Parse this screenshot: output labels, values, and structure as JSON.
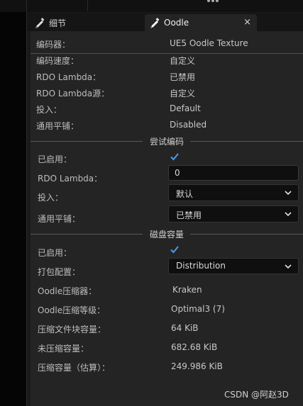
{
  "tabs": [
    {
      "label": "细节"
    },
    {
      "label": "Oodle",
      "close": "×"
    }
  ],
  "info": [
    {
      "label": "编码器：",
      "value": "UE5 Oodle Texture"
    },
    {
      "label": "编码速度：",
      "value": "自定义"
    },
    {
      "label": "RDO Lambda：",
      "value": "已禁用"
    },
    {
      "label": "RDO Lambda源：",
      "value": "自定义"
    },
    {
      "label": "投入：",
      "value": "Default"
    },
    {
      "label": "通用平铺：",
      "value": "Disabled"
    }
  ],
  "try_encode": {
    "title": "尝试编码",
    "enabled_label": "已启用：",
    "enabled": true,
    "rdo_label": "RDO Lambda：",
    "rdo_value": "0",
    "effort_label": "投入：",
    "effort_value": "默认",
    "tiling_label": "通用平铺：",
    "tiling_value": "已禁用"
  },
  "disk": {
    "title": "磁盘容量",
    "enabled_label": "已启用：",
    "enabled": true,
    "pack_label": "打包配置：",
    "pack_value": "Distribution",
    "rows": [
      {
        "label": "Oodle压缩器：",
        "value": "Kraken"
      },
      {
        "label": "Oodle压缩等级：",
        "value": "Optimal3 (7)"
      },
      {
        "label": "压缩文件块容量：",
        "value": "64 KiB"
      },
      {
        "label": "未压缩容量：",
        "value": "682.68 KiB"
      },
      {
        "label": "压缩容量（估算）：",
        "value": "249.986 KiB"
      }
    ]
  },
  "watermark": "CSDN @阿赵3D",
  "colors": {
    "accent": "#4a9cf0",
    "panel": "#242424",
    "field": "#0f0f0f"
  }
}
